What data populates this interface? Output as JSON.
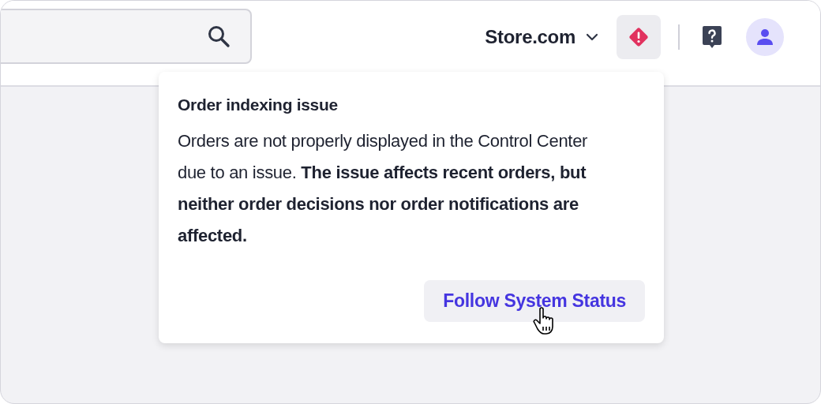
{
  "header": {
    "store": "Store.com"
  },
  "alert": {
    "title": "Order indexing issue",
    "body": "Orders are not properly displayed in the Control Center due to an issue. **The issue affects recent orders, but neither order decisions nor order notifications are affected.**",
    "button": "Follow System Status"
  }
}
